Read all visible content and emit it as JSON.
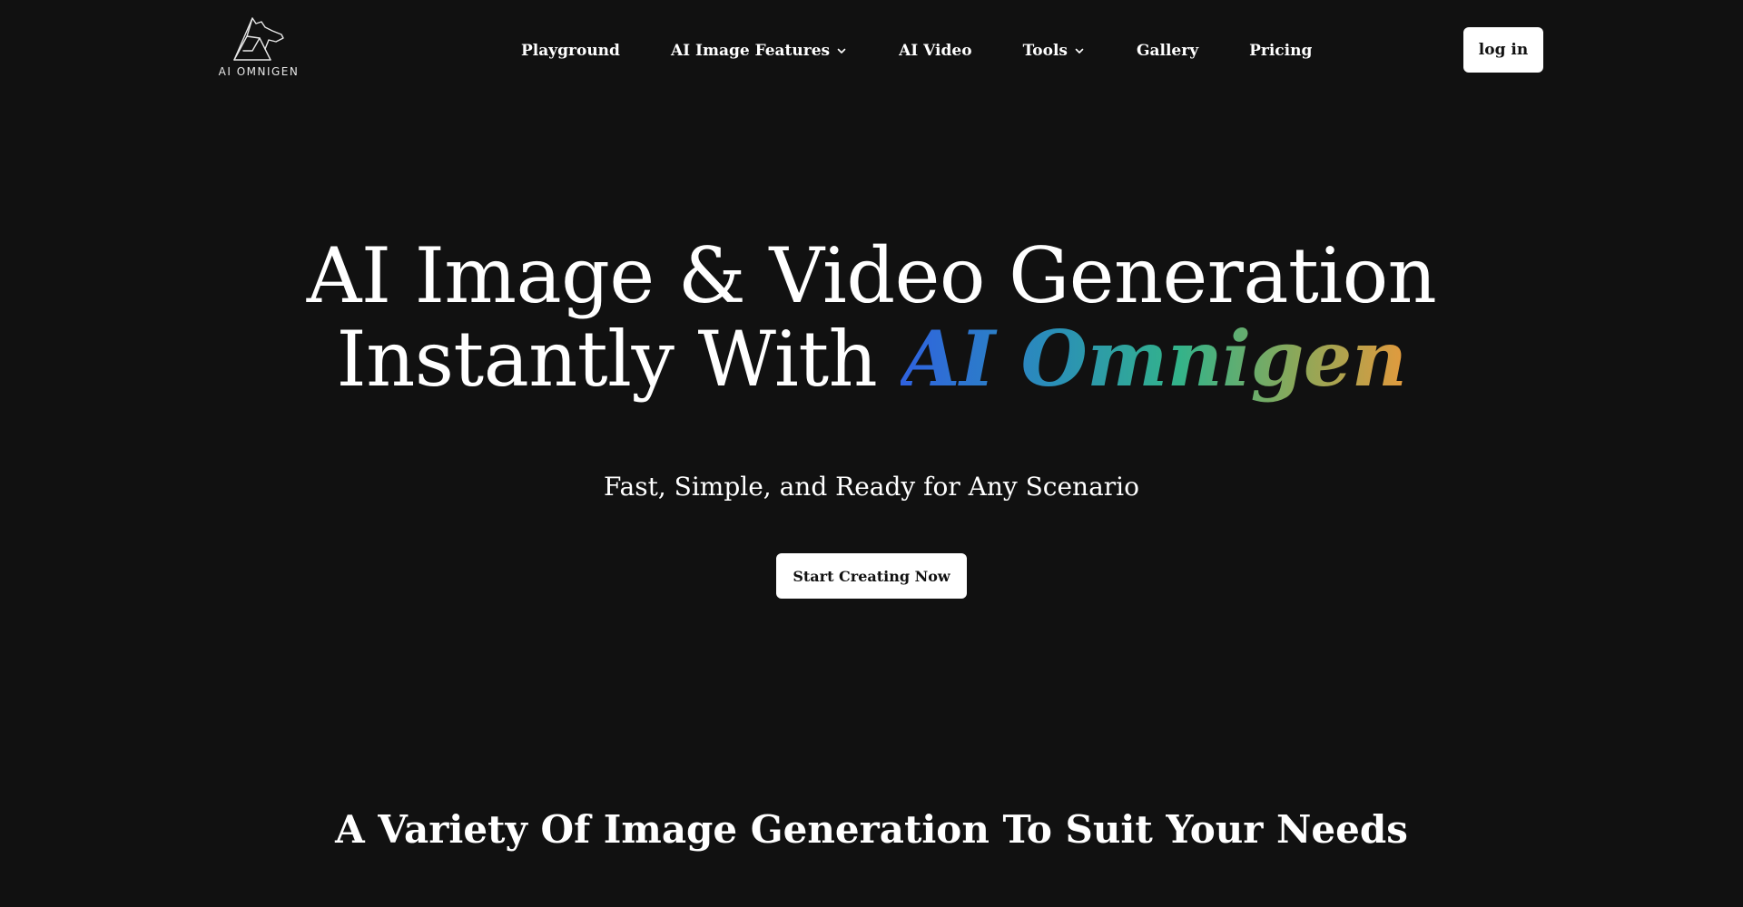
{
  "header": {
    "logo_text": "AI OMNIGEN",
    "nav": [
      {
        "label": "Playground",
        "has_dropdown": false
      },
      {
        "label": "AI Image Features",
        "has_dropdown": true
      },
      {
        "label": "AI Video",
        "has_dropdown": false
      },
      {
        "label": "Tools",
        "has_dropdown": true
      },
      {
        "label": "Gallery",
        "has_dropdown": false
      },
      {
        "label": "Pricing",
        "has_dropdown": false
      }
    ],
    "login_label": "log in"
  },
  "hero": {
    "title_line1": "AI Image & Video Generation",
    "title_line2_prefix": "Instantly With ",
    "title_line2_highlight": "AI Omnigen",
    "subtitle": "Fast, Simple, and Ready for Any Scenario",
    "cta_label": "Start Creating Now"
  },
  "section": {
    "title": "A Variety Of Image Generation To Suit Your Needs"
  },
  "colors": {
    "background": "#111111",
    "text": "#ffffff",
    "button_bg": "#ffffff",
    "button_text": "#111111",
    "gradient_start": "#2f62e0",
    "gradient_mid": "#33b38a",
    "gradient_end": "#e39a3d"
  },
  "icons": {
    "logo": "dog-line-logo-icon",
    "dropdown": "chevron-down-icon"
  }
}
